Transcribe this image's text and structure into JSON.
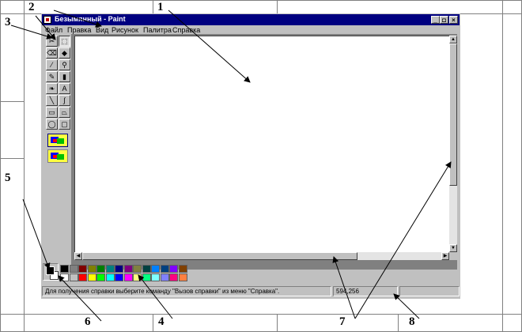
{
  "window": {
    "title": "Безымянный - Paint",
    "min_glyph": "_",
    "max_glyph": "◘",
    "close_glyph": "×"
  },
  "menu": [
    "Файл",
    "Правка",
    "Вид",
    "Рисунок",
    "Палитра",
    "Справка"
  ],
  "tools": [
    {
      "name": "free-select-icon",
      "glyph": "✂"
    },
    {
      "name": "rect-select-icon",
      "glyph": "⬚"
    },
    {
      "name": "eraser-icon",
      "glyph": "⌫"
    },
    {
      "name": "fill-icon",
      "glyph": "◆"
    },
    {
      "name": "pick-color-icon",
      "glyph": "⁄"
    },
    {
      "name": "magnifier-icon",
      "glyph": "⚲"
    },
    {
      "name": "pencil-icon",
      "glyph": "✎"
    },
    {
      "name": "brush-icon",
      "glyph": "▮"
    },
    {
      "name": "airbrush-icon",
      "glyph": "❧"
    },
    {
      "name": "text-icon",
      "glyph": "A"
    },
    {
      "name": "line-icon",
      "glyph": "╲"
    },
    {
      "name": "curve-icon",
      "glyph": "∫"
    },
    {
      "name": "rectangle-icon",
      "glyph": "▭"
    },
    {
      "name": "polygon-icon",
      "glyph": "⏢"
    },
    {
      "name": "ellipse-icon",
      "glyph": "◯"
    },
    {
      "name": "rounded-rect-icon",
      "glyph": "▢"
    }
  ],
  "palette_colors": [
    [
      "#000000",
      "#808080",
      "#800000",
      "#808000",
      "#008000",
      "#008080",
      "#000080",
      "#800080",
      "#808040",
      "#004040",
      "#0080ff",
      "#004080",
      "#8000ff",
      "#804000"
    ],
    [
      "#ffffff",
      "#c0c0c0",
      "#ff0000",
      "#ffff00",
      "#00ff00",
      "#00ffff",
      "#0000ff",
      "#ff00ff",
      "#ffff80",
      "#00ff80",
      "#80ffff",
      "#8080ff",
      "#ff0080",
      "#ff8040"
    ]
  ],
  "status": {
    "help": "Для получения справки выберите команду \"Вызов справки\" из меню \"Справка\".",
    "coords": "594,256",
    "size": ""
  },
  "callouts": [
    "1",
    "2",
    "3",
    "4",
    "5",
    "6",
    "7",
    "8"
  ]
}
